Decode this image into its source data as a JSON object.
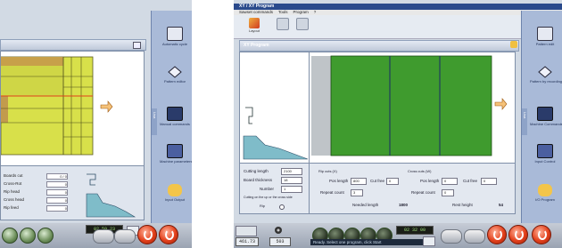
{
  "left_screen": {
    "dock_items": [
      {
        "label": "Automatic cycle",
        "icon": "book-icon"
      },
      {
        "label": "Pattern editor",
        "icon": "diamond-icon"
      },
      {
        "label": "Manual commands",
        "icon": "monitor-icon"
      },
      {
        "label": "Machine parameters",
        "icon": "tools-icon"
      },
      {
        "label": "Input Output",
        "icon": "hand-icon"
      }
    ],
    "dock_tab_text": "Lisa",
    "fields": [
      {
        "label": "Boards cut",
        "value": "0 / 0"
      },
      {
        "label": "Cross-Rot",
        "value": "0"
      },
      {
        "label": "Rip head",
        "value": "0"
      },
      {
        "label": "Cross head",
        "value": "0"
      },
      {
        "label": "Rip feed",
        "value": "0"
      }
    ],
    "lcd_readout": "02 59 23"
  },
  "right_screen": {
    "title": "XY / XY Program",
    "menu": [
      "Sawset commands",
      "Tools",
      "Program",
      "?"
    ],
    "toolbar": [
      {
        "label": "Layout",
        "icon": "layout-icon"
      },
      {
        "label": "",
        "icon": "tool-x-icon"
      },
      {
        "label": "",
        "icon": "trash-icon"
      }
    ],
    "section_title": "XY Program",
    "dock_items": [
      {
        "label": "Pattern edit",
        "icon": "book-icon"
      },
      {
        "label": "Pattern by recording",
        "icon": "diamond-icon"
      },
      {
        "label": "Machine Commands",
        "icon": "monitor-icon"
      },
      {
        "label": "Input Control",
        "icon": "tools-icon"
      },
      {
        "label": "I/O Program",
        "icon": "hand-icon"
      }
    ],
    "dock_tab_text": "Lisa",
    "params": [
      {
        "label": "Cutting length",
        "value": "2100"
      },
      {
        "label": "Board thickness",
        "value": "18"
      },
      {
        "label": "Number",
        "value": "1"
      }
    ],
    "params_note": "Cutting on the up or the cross side",
    "params_note2": "Rip",
    "rip_group": {
      "title": "Rip cuts (X)",
      "fields": [
        {
          "label": "Pos length",
          "value": "800"
        },
        {
          "label": "Cut free",
          "value": "0"
        },
        {
          "label": "Repeat count",
          "value": "3"
        }
      ]
    },
    "cross_group": {
      "title": "Cross cuts (W)",
      "fields": [
        {
          "label": "Pos length",
          "value": "0"
        },
        {
          "label": "Cut free",
          "value": "0"
        },
        {
          "label": "Repeat count",
          "value": "0"
        }
      ]
    },
    "summary": [
      {
        "label": "Needed length",
        "value": "1800"
      },
      {
        "label": "Rest height",
        "value": "54"
      }
    ],
    "readouts": {
      "left_value": "461.73",
      "mid_value": "503",
      "lcd": "02 32 00"
    },
    "status_message": "Ready. Select one program, click Start"
  },
  "colors": {
    "board_green": "#3f9b2e",
    "panel_yellow": "#d8e04a",
    "stop_red": "#e2401b",
    "screen_bg": "#d2dae4"
  }
}
